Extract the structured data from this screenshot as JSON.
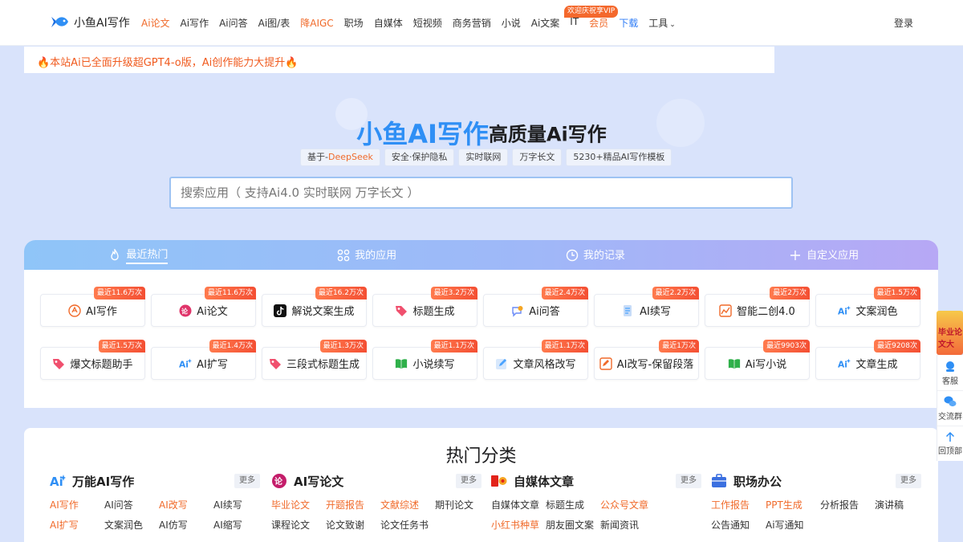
{
  "nav": {
    "logo_text": "小鱼AI写作",
    "items": [
      {
        "label": "Ai论文",
        "style": "orange"
      },
      {
        "label": "Ai写作",
        "style": ""
      },
      {
        "label": "Ai问答",
        "style": ""
      },
      {
        "label": "Ai图/表",
        "style": ""
      },
      {
        "label": "降AIGC",
        "style": "orange"
      },
      {
        "label": "职场",
        "style": ""
      },
      {
        "label": "自媒体",
        "style": ""
      },
      {
        "label": "短视频",
        "style": ""
      },
      {
        "label": "商务营销",
        "style": ""
      },
      {
        "label": "小说",
        "style": ""
      },
      {
        "label": "Ai文案",
        "style": ""
      },
      {
        "label": "IT",
        "style": ""
      },
      {
        "label": "会员",
        "style": "orange"
      },
      {
        "label": "下载",
        "style": "blue"
      },
      {
        "label": "工具",
        "style": ""
      }
    ],
    "vip_badge": "欢迎庆祝享VIP",
    "tools_caret": "⌄",
    "login": "登录"
  },
  "announcement": "🔥本站Ai已全面升级超GPT4-o版，Ai创作能力大提升🔥",
  "hero": {
    "brand": "小鱼AI写作",
    "subtitle": "高质量Ai写作",
    "tag_deepseek_prefix": "基于-",
    "tag_deepseek_highlight": "DeepSeek",
    "tags": [
      "安全·保护隐私",
      "实时联网",
      "万字长文",
      "5230+精品AI写作模板"
    ]
  },
  "search": {
    "placeholder": "搜索应用（ 支持Ai4.0 实时联网 万字长文 ）"
  },
  "tabs": [
    {
      "label": "最近热门",
      "icon": "flame-icon"
    },
    {
      "label": "我的应用",
      "icon": "apps-grid-icon"
    },
    {
      "label": "我的记录",
      "icon": "clock-icon"
    },
    {
      "label": "自定义应用",
      "icon": "plus-icon"
    }
  ],
  "apps": [
    {
      "label": "AI写作",
      "badge": "最近11.6万次",
      "icon": "write-icon",
      "color": "#f06a2a"
    },
    {
      "label": "Ai论文",
      "badge": "最近11.6万次",
      "icon": "paper-icon",
      "color": "#e0346a"
    },
    {
      "label": "解说文案生成",
      "badge": "最近16.2万次",
      "icon": "tiktok-icon",
      "color": "#111111"
    },
    {
      "label": "标题生成",
      "badge": "最近3.2万次",
      "icon": "tag-icon",
      "color": "#f0506e"
    },
    {
      "label": "Ai问答",
      "badge": "最近2.4万次",
      "icon": "chat-icon",
      "color": "#6b8cf7"
    },
    {
      "label": "AI续写",
      "badge": "最近2.2万次",
      "icon": "continue-icon",
      "color": "#4aa3ff"
    },
    {
      "label": "智能二创4.0",
      "badge": "最近2万次",
      "icon": "chart-icon",
      "color": "#f06a2a"
    },
    {
      "label": "文案润色",
      "badge": "最近1.5万次",
      "icon": "ai-spark-icon",
      "color": "#2f8ff5"
    },
    {
      "label": "爆文标题助手",
      "badge": "最近1.5万次",
      "icon": "tag-icon",
      "color": "#f0506e"
    },
    {
      "label": "AI扩写",
      "badge": "最近1.4万次",
      "icon": "ai-spark-icon",
      "color": "#2f8ff5"
    },
    {
      "label": "三段式标题生成",
      "badge": "最近1.3万次",
      "icon": "tag-icon",
      "color": "#f0506e"
    },
    {
      "label": "小说续写",
      "badge": "最近1.1万次",
      "icon": "book-icon",
      "color": "#2fb04a"
    },
    {
      "label": "文章风格改写",
      "badge": "最近1.1万次",
      "icon": "edit-icon",
      "color": "#4aa3ff"
    },
    {
      "label": "AI改写-保留段落",
      "badge": "最近1万次",
      "icon": "rewrite-icon",
      "color": "#f06a2a"
    },
    {
      "label": "Ai写小说",
      "badge": "最近9903次",
      "icon": "book-icon",
      "color": "#2fb04a"
    },
    {
      "label": "文章生成",
      "badge": "最近9208次",
      "icon": "ai-spark-icon",
      "color": "#2f8ff5"
    }
  ],
  "categories": {
    "title": "热门分类",
    "more_label": "更多",
    "columns": [
      {
        "name": "万能AI写作",
        "icon": "ai-spark-icon",
        "links": [
          {
            "label": "AI写作",
            "hot": true
          },
          {
            "label": "AI问答",
            "hot": false
          },
          {
            "label": "AI改写",
            "hot": true
          },
          {
            "label": "AI续写",
            "hot": false
          },
          {
            "label": "AI扩写",
            "hot": true
          },
          {
            "label": "文案润色",
            "hot": false
          },
          {
            "label": "AI仿写",
            "hot": false
          },
          {
            "label": "AI缩写",
            "hot": false
          }
        ]
      },
      {
        "name": "AI写论文",
        "icon": "paper-icon",
        "links": [
          {
            "label": "毕业论文",
            "hot": true
          },
          {
            "label": "开题报告",
            "hot": true
          },
          {
            "label": "文献综述",
            "hot": true
          },
          {
            "label": "期刊论文",
            "hot": false
          },
          {
            "label": "课程论文",
            "hot": false
          },
          {
            "label": "论文致谢",
            "hot": false
          },
          {
            "label": "论文任务书",
            "hot": false
          }
        ]
      },
      {
        "name": "自媒体文章",
        "icon": "media-icon",
        "links": [
          {
            "label": "自媒体文章",
            "hot": false
          },
          {
            "label": "标题生成",
            "hot": false
          },
          {
            "label": "公众号文章",
            "hot": true
          },
          {
            "label": "",
            "hot": false
          },
          {
            "label": "小红书种草",
            "hot": true
          },
          {
            "label": "朋友圈文案",
            "hot": false
          },
          {
            "label": "新闻资讯",
            "hot": false
          }
        ]
      },
      {
        "name": "职场办公",
        "icon": "briefcase-icon",
        "links": [
          {
            "label": "工作报告",
            "hot": true
          },
          {
            "label": "PPT生成",
            "hot": true
          },
          {
            "label": "分析报告",
            "hot": false
          },
          {
            "label": "演讲稿",
            "hot": false
          },
          {
            "label": "公告通知",
            "hot": false
          },
          {
            "label": "Ai写通知",
            "hot": false
          }
        ]
      }
    ]
  },
  "float_bar": {
    "promo": "毕业论文大",
    "items": [
      {
        "label": "客服",
        "icon": "customer-service-icon"
      },
      {
        "label": "交流群",
        "icon": "wechat-icon"
      },
      {
        "label": "回顶部",
        "icon": "arrow-up-icon"
      }
    ]
  }
}
